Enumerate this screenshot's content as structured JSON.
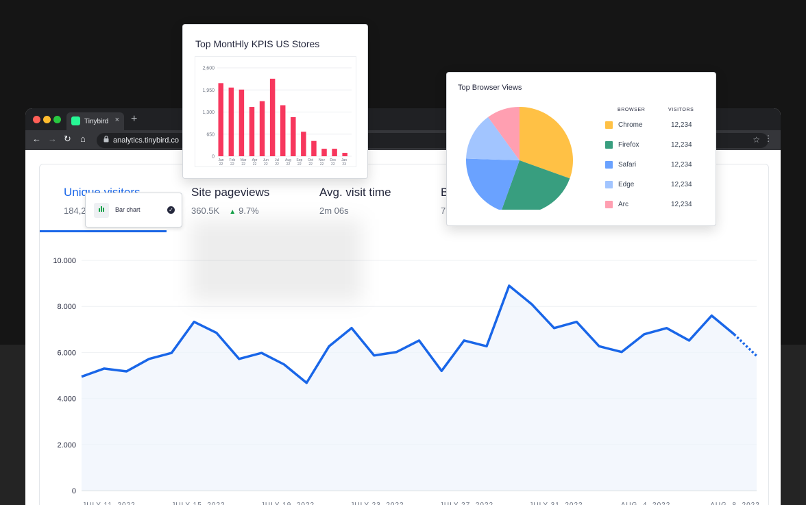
{
  "browser": {
    "tab_title": "Tinybird",
    "tab_close": "×",
    "new_tab": "+",
    "url": "analytics.tinybird.co",
    "nav": {
      "back": "←",
      "forward": "→",
      "reload": "↻",
      "home": "⌂",
      "star": "☆",
      "menu": "⋮",
      "lock": "🔒"
    },
    "dot_colors": [
      "#ff5f57",
      "#febc2e",
      "#28c840"
    ]
  },
  "metrics": [
    {
      "title": "Unique visitors",
      "value": "184,2",
      "active": true
    },
    {
      "title": "Site pageviews",
      "value": "360.5K",
      "trend_icon": "▲",
      "change": "9.7%"
    },
    {
      "title": "Avg. visit time",
      "value": "2m 06s"
    },
    {
      "title": "B",
      "value": "7"
    }
  ],
  "tooltip": {
    "label": "Bar chart",
    "icon": "bar-chart-icon",
    "check": "✓"
  },
  "chart_data": [
    {
      "type": "line",
      "title": "",
      "xlabel": "",
      "ylabel": "",
      "ylim": [
        0,
        10000
      ],
      "y_ticks": [
        "0",
        "2.000",
        "4.000",
        "6.000",
        "8.000",
        "10.000"
      ],
      "x_ticks": [
        "JULY 11, 2022",
        "JULY 15, 2022",
        "JULY 19, 2022",
        "JULY 23, 2022",
        "JULY 27, 2022",
        "JULY 31, 2022",
        "AUG. 4, 2022",
        "AUG. 8, 2022"
      ],
      "series": [
        {
          "values": [
            4950,
            5300,
            5180,
            5720,
            5980,
            7330,
            6850,
            5720,
            5980,
            5480,
            4680,
            6270,
            7060,
            5870,
            6020,
            6520,
            5200,
            6520,
            6270,
            8900,
            8100,
            7060,
            7330,
            6270,
            6020,
            6790,
            7060,
            6520,
            7600,
            6790,
            5850
          ],
          "projected_from_index": 29,
          "color": "#1966e8"
        }
      ],
      "grid": true
    },
    {
      "type": "bar",
      "title": "Top MontHly KPIS US Stores",
      "categories": [
        "Jan 22",
        "Feb 22",
        "Mar 22",
        "Apr 22",
        "Jun 22",
        "Jul 22",
        "Aug 22",
        "Sep 22",
        "Oct 22",
        "Nov 22",
        "Dec 22",
        "Jan 23"
      ],
      "category_labels": [
        [
          "Jan",
          "22"
        ],
        [
          "Feb",
          "22"
        ],
        [
          "Mar",
          "22"
        ],
        [
          "Apr",
          "22"
        ],
        [
          "Jun",
          "22"
        ],
        [
          "Jul",
          "22"
        ],
        [
          "Aug",
          "22"
        ],
        [
          "Sep",
          "22"
        ],
        [
          "Oct",
          "22"
        ],
        [
          "Nov",
          "22"
        ],
        [
          "Dec",
          "22"
        ],
        [
          "Jan",
          "23"
        ]
      ],
      "values": [
        2150,
        2020,
        1960,
        1450,
        1620,
        2280,
        1500,
        1150,
        720,
        450,
        220,
        220,
        100
      ],
      "bar_categories_full": [
        "",
        "",
        "",
        "",
        "",
        "",
        "",
        "",
        "",
        "",
        "",
        "",
        ""
      ],
      "y_ticks": [
        "0",
        "650",
        "1,300",
        "1,950",
        "2,600"
      ],
      "ylim": [
        0,
        2600
      ],
      "color": "#f7375d",
      "grid": true
    },
    {
      "type": "pie",
      "title": "Top Browser Views",
      "column_headers": [
        "BROWSER",
        "VISITORS"
      ],
      "slices": [
        {
          "name": "Chrome",
          "value": 12234,
          "display": "12,234",
          "color": "#ffc145"
        },
        {
          "name": "Firefox",
          "value": 12234,
          "display": "12,234",
          "color": "#389e7f"
        },
        {
          "name": "Safari",
          "value": 12234,
          "display": "12,234",
          "color": "#6aa2ff"
        },
        {
          "name": "Edge",
          "value": 12234,
          "display": "12,234",
          "color": "#a2c5ff"
        },
        {
          "name": "Arc",
          "value": 12234,
          "display": "12,234",
          "color": "#ff9fb1"
        }
      ],
      "pie_shares": [
        0.305,
        0.25,
        0.2,
        0.145,
        0.1
      ],
      "legend_position": "right"
    }
  ]
}
